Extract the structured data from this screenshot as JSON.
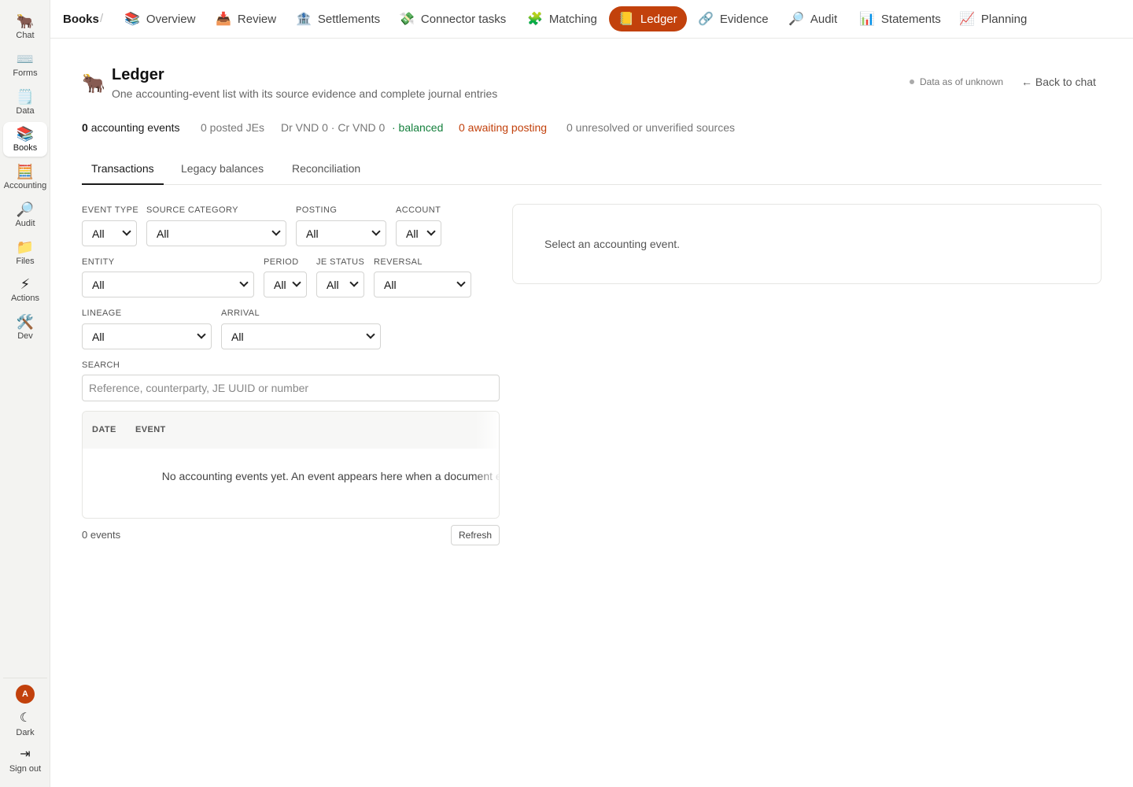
{
  "rail": {
    "items": [
      {
        "label": "Chat",
        "icon": "🐂"
      },
      {
        "label": "Forms",
        "icon": "⌨️"
      },
      {
        "label": "Data",
        "icon": "🗒️"
      },
      {
        "label": "Books",
        "icon": "📚"
      },
      {
        "label": "Accounting",
        "icon": "🧮"
      },
      {
        "label": "Audit",
        "icon": "🔎"
      },
      {
        "label": "Files",
        "icon": "📁"
      },
      {
        "label": "Actions",
        "icon": "⚡"
      },
      {
        "label": "Dev",
        "icon": "🛠️"
      }
    ],
    "avatar": "A",
    "dark": {
      "label": "Dark",
      "icon": "☾"
    },
    "signout": {
      "label": "Sign out",
      "icon": "⇥"
    }
  },
  "topnav": {
    "breadcrumb": "Books",
    "sep": "/",
    "tabs": [
      {
        "label": "Overview",
        "icon": "📚"
      },
      {
        "label": "Review",
        "icon": "📥"
      },
      {
        "label": "Settlements",
        "icon": "🏦"
      },
      {
        "label": "Connector tasks",
        "icon": "💸"
      },
      {
        "label": "Matching",
        "icon": "🧩"
      },
      {
        "label": "Ledger",
        "icon": "📒"
      },
      {
        "label": "Evidence",
        "icon": "🔗"
      },
      {
        "label": "Audit",
        "icon": "🔎"
      },
      {
        "label": "Statements",
        "icon": "📊"
      },
      {
        "label": "Planning",
        "icon": "📈"
      }
    ],
    "active_tab": "Ledger",
    "accent": "#c2410c"
  },
  "header": {
    "icon": "🐂",
    "title": "Ledger",
    "subtitle": "One accounting-event list with its source evidence and complete journal entries",
    "data_as_of": "Data as of unknown",
    "back": "← Back to chat"
  },
  "summary": {
    "events_count": "0",
    "events_label": "accounting events",
    "posted": "0 posted JEs",
    "totals": "Dr VND 0 · Cr VND 0",
    "balanced": "· balanced",
    "awaiting": "0 awaiting posting",
    "unresolved": "0 unresolved or unverified sources",
    "colors": {
      "balanced": "#15803d",
      "awaiting": "#c2410c"
    }
  },
  "subtabs": {
    "items": [
      "Transactions",
      "Legacy balances",
      "Reconciliation"
    ],
    "active": "Transactions"
  },
  "filters": {
    "event_type": {
      "label": "EVENT TYPE",
      "value": "All"
    },
    "source_category": {
      "label": "SOURCE CATEGORY",
      "value": "All"
    },
    "posting": {
      "label": "POSTING",
      "value": "All"
    },
    "account": {
      "label": "ACCOUNT",
      "value": "All"
    },
    "entity": {
      "label": "ENTITY",
      "value": "All"
    },
    "period": {
      "label": "PERIOD",
      "value": "All"
    },
    "je_status": {
      "label": "JE STATUS",
      "value": "All"
    },
    "reversal": {
      "label": "REVERSAL",
      "value": "All"
    },
    "lineage": {
      "label": "LINEAGE",
      "value": "All"
    },
    "arrival": {
      "label": "ARRIVAL",
      "value": "All"
    }
  },
  "search": {
    "label": "SEARCH",
    "placeholder": "Reference, counterparty, JE UUID or number",
    "value": ""
  },
  "table": {
    "columns": [
      "DATE",
      "EVENT"
    ],
    "empty": "No accounting events yet. An event appears here when a document enters a journal entry.",
    "count": "0 events",
    "refresh": "Refresh"
  },
  "detail": {
    "placeholder": "Select an accounting event."
  }
}
